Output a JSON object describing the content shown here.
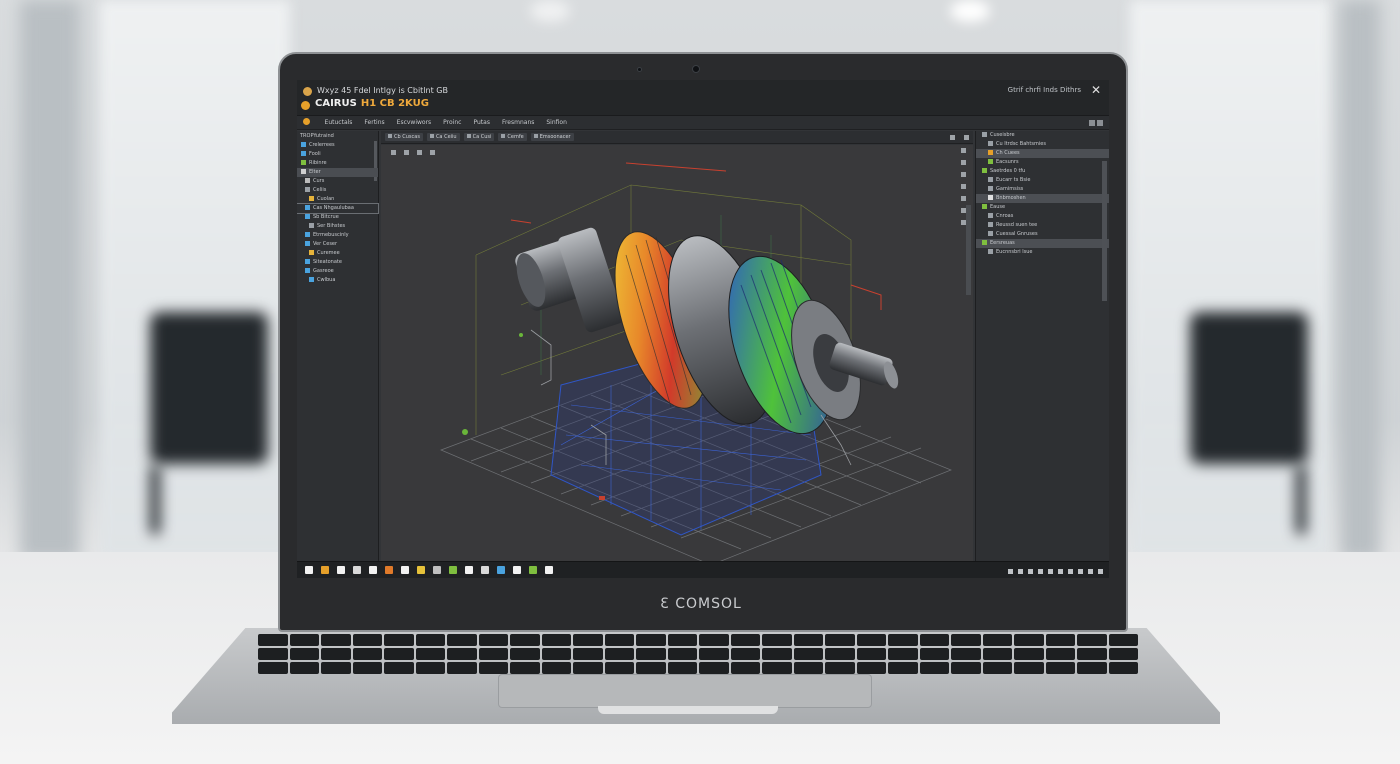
{
  "window": {
    "title": "Wxyz 45 Fdel Intlgy is Cbitlnt GB",
    "app_name_primary": "CAIRUS",
    "app_name_secondary": "H1 CB 2KUG",
    "window_controls": "Gtrif chrfi Inds Dithrs",
    "close_glyph": "✕"
  },
  "menu": {
    "items": [
      "Eutuctals",
      "Fertins",
      "Escvwiwors",
      "Proinc",
      "Putas",
      "Fresmnans",
      "Sinfion"
    ]
  },
  "tree": {
    "header": "TROPYutraind",
    "items": [
      {
        "label": "Crelerrees",
        "color": "#4aa3df"
      },
      {
        "label": "Fooli",
        "color": "#4aa3df"
      },
      {
        "label": "Ribinre",
        "color": "#7fbf3f"
      },
      {
        "label": "Elter",
        "color": "#d0d0d0"
      },
      {
        "label": "Curs",
        "color": "#bbbbbb"
      },
      {
        "label": "Celiis",
        "color": "#9aa0a6"
      },
      {
        "label": "Cuolan",
        "color": "#e6b33a"
      },
      {
        "label": "Cas Nhgaulubaa",
        "color": "#4aa3df"
      },
      {
        "label": "Sb Bitcrue",
        "color": "#4aa3df"
      },
      {
        "label": "Ser Bihstes",
        "color": "#9aa0a6"
      },
      {
        "label": "Etrmebuscinly",
        "color": "#4aa3df"
      },
      {
        "label": "Ver Ceser",
        "color": "#4aa3df"
      },
      {
        "label": "Curemee",
        "color": "#e6b33a"
      },
      {
        "label": "Siteatonate",
        "color": "#4aa3df"
      },
      {
        "label": "Gasreoe",
        "color": "#4aa3df"
      },
      {
        "label": "Cwlbua",
        "color": "#4aa3df"
      }
    ]
  },
  "toolbar": {
    "buttons": [
      "Cb Cuscas",
      "Ca Ceiiu",
      "Ca Cusi",
      "Cemfe",
      "Emsoonacer"
    ]
  },
  "right_panel": {
    "items": [
      {
        "label": "Cuseisbre",
        "color": "#9aa0a6"
      },
      {
        "label": "Cu Itrdsc Bahtsmies",
        "color": "#9aa0a6"
      },
      {
        "label": "Ch Cuees",
        "color": "#e6a02a"
      },
      {
        "label": "Eacsunrs",
        "color": "#7fbf3f"
      },
      {
        "label": "Saetrdes 0 tfu",
        "color": "#7fbf3f"
      },
      {
        "label": "Eucarr ts Bsie",
        "color": "#9aa0a6"
      },
      {
        "label": "Gamimsiss",
        "color": "#9aa0a6"
      },
      {
        "label": "Bnbmoshen",
        "color": "#e0e0e0"
      },
      {
        "label": "Eause",
        "color": "#7fbf3f"
      },
      {
        "label": "Cnroas",
        "color": "#9aa0a6"
      },
      {
        "label": "Reussd suen tee",
        "color": "#9aa0a6"
      },
      {
        "label": "Cuessal Gnruses",
        "color": "#9aa0a6"
      },
      {
        "label": "Eersreuas",
        "color": "#7fbf3f"
      },
      {
        "label": "Eucnnsbri lsue",
        "color": "#9aa0a6"
      }
    ]
  },
  "taskbar": {
    "icons": [
      "#f2f2f2",
      "#e6a02a",
      "#f2f2f2",
      "#d9d9d9",
      "#f2f2f2",
      "#e07a2a",
      "#f2f2f2",
      "#e6c23a",
      "#bfbfbf",
      "#7fbf3f",
      "#f2f2f2",
      "#d9d9d9",
      "#4aa3df",
      "#f2f2f2",
      "#7fbf3f",
      "#f2f2f2"
    ]
  },
  "laptop": {
    "brand": "Ɛ COMSOL"
  },
  "colors": {
    "accent": "#e6a02a",
    "screen_bg": "#323437",
    "viewport_bg": "#39393b"
  }
}
